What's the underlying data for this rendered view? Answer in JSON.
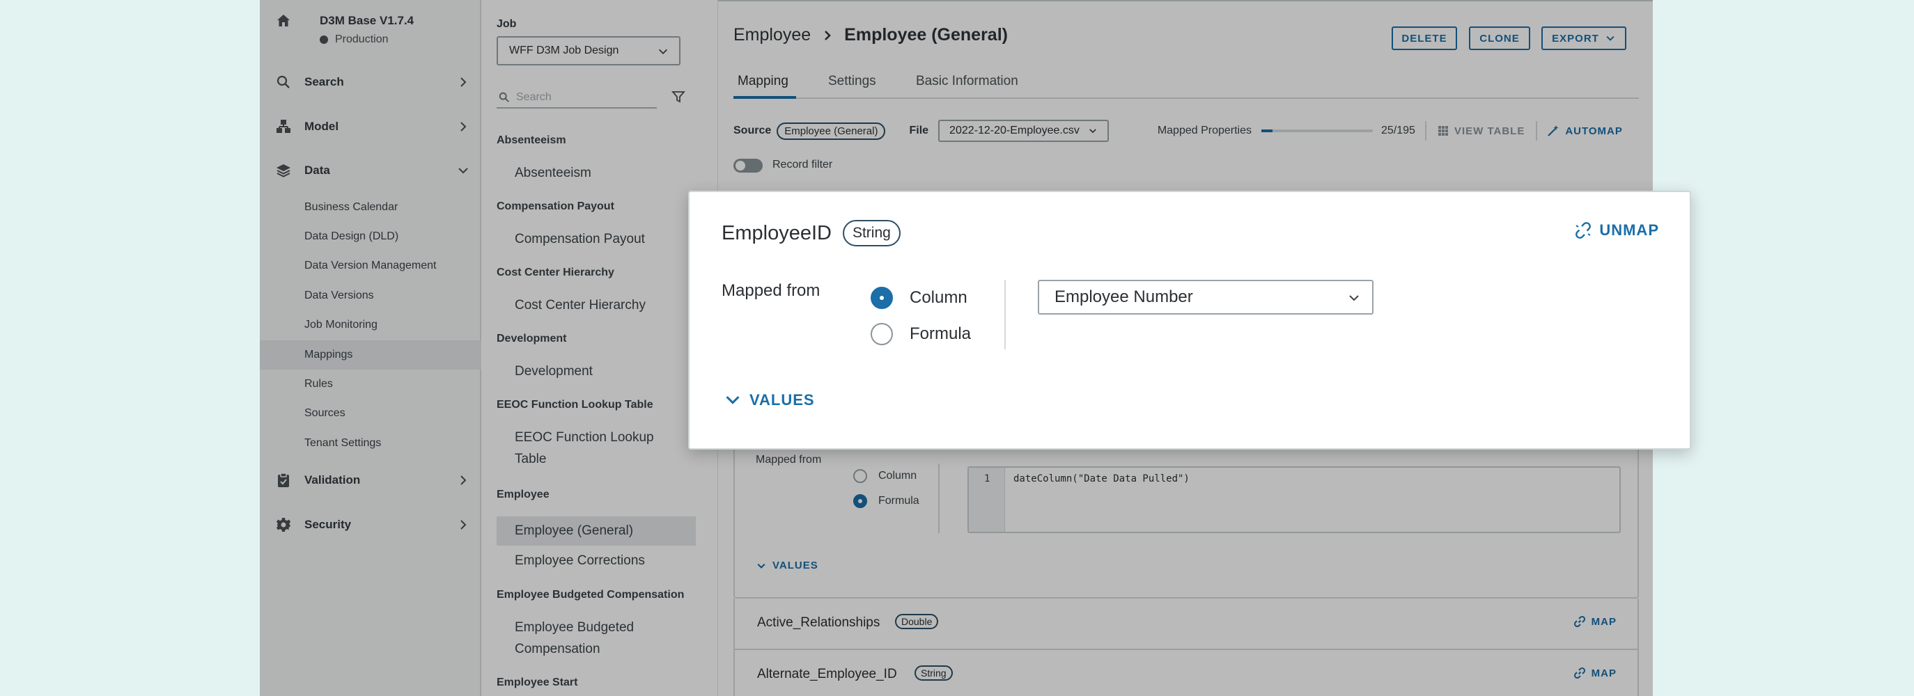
{
  "colors": {
    "accent": "#1b6ea8",
    "backdrop": "#e3f3f2"
  },
  "sidebar": {
    "app_name": "D3M Base V1.7.4",
    "environment": "Production",
    "nav": [
      {
        "label": "Search",
        "icon": "search-icon"
      },
      {
        "label": "Model",
        "icon": "model-icon"
      },
      {
        "label": "Data",
        "icon": "layers-icon",
        "expanded": true
      },
      {
        "label": "Validation",
        "icon": "clipboard-icon"
      },
      {
        "label": "Security",
        "icon": "gear-icon"
      }
    ],
    "data_items": [
      "Business Calendar",
      "Data Design (DLD)",
      "Data Version Management",
      "Data Versions",
      "Job Monitoring",
      "Mappings",
      "Rules",
      "Sources",
      "Tenant Settings"
    ],
    "active_item": "Mappings"
  },
  "midcol": {
    "job_label": "Job",
    "job_value": "WFF D3M Job Design",
    "search_placeholder": "Search",
    "groups": [
      {
        "heading": "Absenteeism",
        "items": [
          "Absenteeism"
        ]
      },
      {
        "heading": "Compensation Payout",
        "items": [
          "Compensation Payout"
        ]
      },
      {
        "heading": "Cost Center Hierarchy",
        "items": [
          "Cost Center Hierarchy"
        ]
      },
      {
        "heading": "Development",
        "items": [
          "Development"
        ]
      },
      {
        "heading": "EEOC Function Lookup Table",
        "items": [
          "EEOC Function Lookup Table"
        ]
      },
      {
        "heading": "Employee",
        "items": [
          "Employee (General)",
          "Employee Corrections"
        ]
      },
      {
        "heading": "Employee Budgeted Compensation",
        "items": [
          "Employee Budgeted Compensation"
        ]
      },
      {
        "heading": "Employee Start",
        "items": []
      }
    ],
    "active_item": "Employee (General)"
  },
  "content": {
    "breadcrumb": {
      "parent": "Employee",
      "current": "Employee (General)"
    },
    "buttons": {
      "delete": "DELETE",
      "clone": "CLONE",
      "export": "EXPORT"
    },
    "tabs": [
      "Mapping",
      "Settings",
      "Basic Information"
    ],
    "active_tab": "Mapping",
    "source_label": "Source",
    "source_value": "Employee (General)",
    "file_label": "File",
    "file_value": "2022-12-20-Employee.csv",
    "mapped_label": "Mapped Properties",
    "mapped_fraction": 0.128,
    "mapped_text": "25/195",
    "view_table": "VIEW TABLE",
    "automap": "AUTOMAP",
    "record_filter": "Record filter",
    "bg_card": {
      "mapped_from": "Mapped from",
      "column_label": "Column",
      "formula_label": "Formula",
      "line_number": "1",
      "code": "dateColumn(\"Date Data Pulled\")",
      "values_label": "VALUES"
    },
    "properties": [
      {
        "name": "Active_Relationships",
        "type": "Double",
        "action": "MAP"
      },
      {
        "name": "Alternate_Employee_ID",
        "type": "String",
        "action": "MAP"
      }
    ]
  },
  "modal": {
    "field_name": "EmployeeID",
    "field_type": "String",
    "unmap_label": "UNMAP",
    "mapped_from": "Mapped from",
    "column_label": "Column",
    "formula_label": "Formula",
    "selected_mode": "Column",
    "column_value": "Employee Number",
    "values_label": "VALUES"
  }
}
